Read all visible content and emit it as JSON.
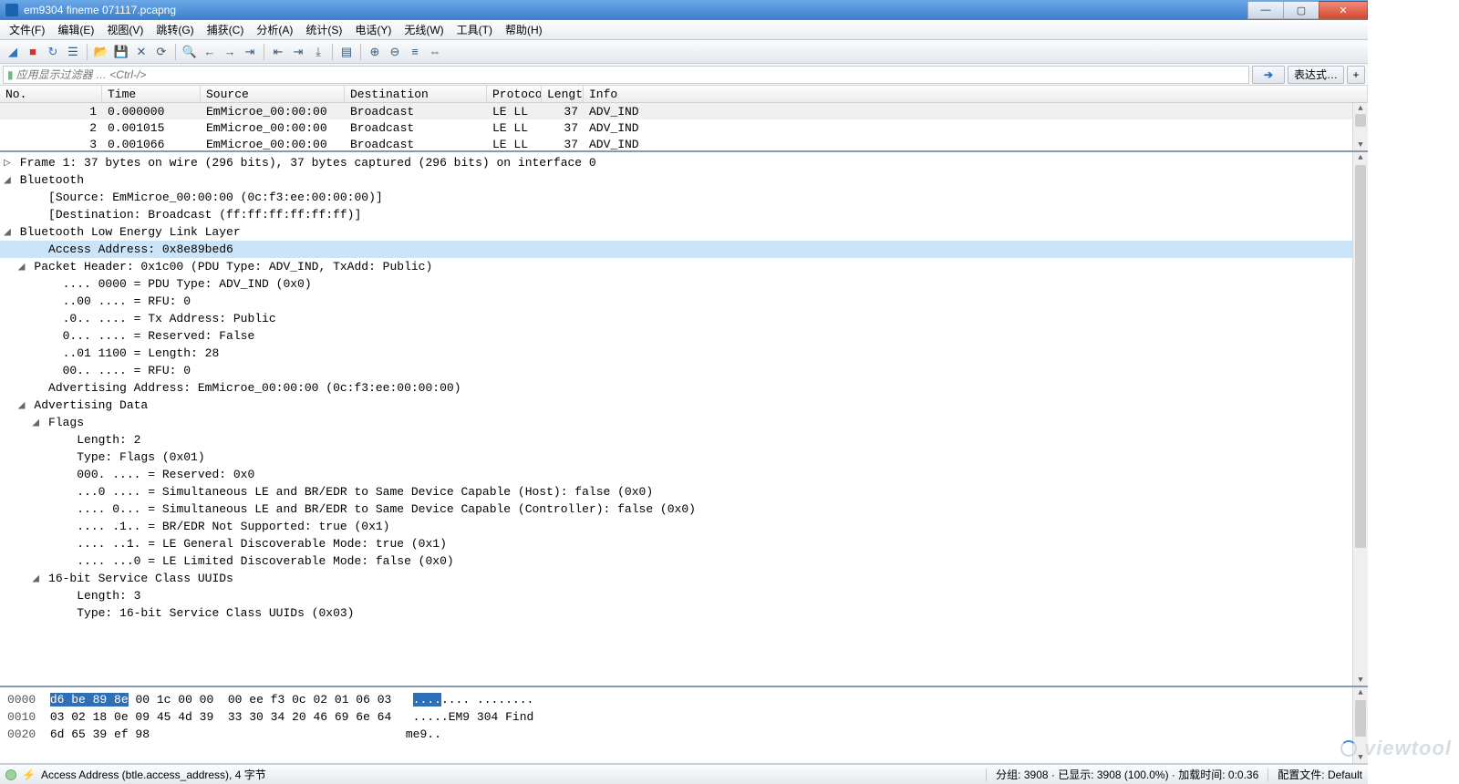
{
  "title": "em9304 fineme 071117.pcapng",
  "window_buttons": {
    "min": "—",
    "max": "▢",
    "close": "✕"
  },
  "menu": [
    "文件(F)",
    "编辑(E)",
    "视图(V)",
    "跳转(G)",
    "捕获(C)",
    "分析(A)",
    "统计(S)",
    "电话(Y)",
    "无线(W)",
    "工具(T)",
    "帮助(H)"
  ],
  "filter": {
    "icon": "▮",
    "placeholder": "应用显示过滤器 … <Ctrl-/>",
    "expr_label": "表达式…",
    "arrow": "➔",
    "plus": "+"
  },
  "columns": [
    "No.",
    "Time",
    "Source",
    "Destination",
    "Protocol",
    "Length",
    "Info"
  ],
  "packets": [
    {
      "no": "1",
      "time": "0.000000",
      "src": "EmMicroe_00:00:00",
      "dst": "Broadcast",
      "pro": "LE LL",
      "len": "37",
      "info": "ADV_IND"
    },
    {
      "no": "2",
      "time": "0.001015",
      "src": "EmMicroe_00:00:00",
      "dst": "Broadcast",
      "pro": "LE LL",
      "len": "37",
      "info": "ADV_IND"
    },
    {
      "no": "3",
      "time": "0.001066",
      "src": "EmMicroe_00:00:00",
      "dst": "Broadcast",
      "pro": "LE LL",
      "len": "37",
      "info": "ADV_IND"
    }
  ],
  "tree": [
    {
      "ind": 0,
      "tri": "▷",
      "txt": "Frame 1: 37 bytes on wire (296 bits), 37 bytes captured (296 bits) on interface 0"
    },
    {
      "ind": 0,
      "tri": "◢",
      "txt": "Bluetooth"
    },
    {
      "ind": 2,
      "tri": "",
      "txt": "[Source: EmMicroe_00:00:00 (0c:f3:ee:00:00:00)]"
    },
    {
      "ind": 2,
      "tri": "",
      "txt": "[Destination: Broadcast (ff:ff:ff:ff:ff:ff)]"
    },
    {
      "ind": 0,
      "tri": "◢",
      "txt": "Bluetooth Low Energy Link Layer"
    },
    {
      "ind": 2,
      "tri": "",
      "txt": "Access Address: 0x8e89bed6",
      "sel": true
    },
    {
      "ind": 1,
      "tri": "◢",
      "txt": "Packet Header: 0x1c00 (PDU Type: ADV_IND, TxAdd: Public)"
    },
    {
      "ind": 3,
      "tri": "",
      "txt": ".... 0000 = PDU Type: ADV_IND (0x0)"
    },
    {
      "ind": 3,
      "tri": "",
      "txt": "..00 .... = RFU: 0"
    },
    {
      "ind": 3,
      "tri": "",
      "txt": ".0.. .... = Tx Address: Public"
    },
    {
      "ind": 3,
      "tri": "",
      "txt": "0... .... = Reserved: False"
    },
    {
      "ind": 3,
      "tri": "",
      "txt": "..01 1100 = Length: 28"
    },
    {
      "ind": 3,
      "tri": "",
      "txt": "00.. .... = RFU: 0"
    },
    {
      "ind": 2,
      "tri": "",
      "txt": "Advertising Address: EmMicroe_00:00:00 (0c:f3:ee:00:00:00)"
    },
    {
      "ind": 1,
      "tri": "◢",
      "txt": "Advertising Data"
    },
    {
      "ind": 2,
      "tri": "◢",
      "txt": "Flags"
    },
    {
      "ind": 4,
      "tri": "",
      "txt": "Length: 2"
    },
    {
      "ind": 4,
      "tri": "",
      "txt": "Type: Flags (0x01)"
    },
    {
      "ind": 4,
      "tri": "",
      "txt": "000. .... = Reserved: 0x0"
    },
    {
      "ind": 4,
      "tri": "",
      "txt": "...0 .... = Simultaneous LE and BR/EDR to Same Device Capable (Host): false (0x0)"
    },
    {
      "ind": 4,
      "tri": "",
      "txt": ".... 0... = Simultaneous LE and BR/EDR to Same Device Capable (Controller): false (0x0)"
    },
    {
      "ind": 4,
      "tri": "",
      "txt": ".... .1.. = BR/EDR Not Supported: true (0x1)"
    },
    {
      "ind": 4,
      "tri": "",
      "txt": ".... ..1. = LE General Discoverable Mode: true (0x1)"
    },
    {
      "ind": 4,
      "tri": "",
      "txt": ".... ...0 = LE Limited Discoverable Mode: false (0x0)"
    },
    {
      "ind": 2,
      "tri": "◢",
      "txt": "16-bit Service Class UUIDs"
    },
    {
      "ind": 4,
      "tri": "",
      "txt": "Length: 3"
    },
    {
      "ind": 4,
      "tri": "",
      "txt": "Type: 16-bit Service Class UUIDs (0x03)"
    }
  ],
  "hex": {
    "rows": [
      {
        "off": "0000",
        "sel": "d6 be 89 8e",
        "rest": " 00 1c 00 00  00 ee f3 0c 02 01 06 03   ",
        "asc_sel": "....",
        "asc_rest": ".... ........"
      },
      {
        "off": "0010",
        "sel": "",
        "rest": "03 02 18 0e 09 45 4d 39  33 30 34 20 46 69 6e 64   ",
        "asc_sel": "",
        "asc_rest": ".....EM9 304 Find"
      },
      {
        "off": "0020",
        "sel": "",
        "rest": "6d 65 39 ef 98                                    ",
        "asc_sel": "",
        "asc_rest": "me9.."
      }
    ]
  },
  "status": {
    "left": "Access Address (btle.access_address), 4 字节",
    "right1": "分组: 3908 · 已显示: 3908 (100.0%) · 加载时间: 0:0.36",
    "right2": "配置文件: Default"
  },
  "watermark": "viewtool"
}
